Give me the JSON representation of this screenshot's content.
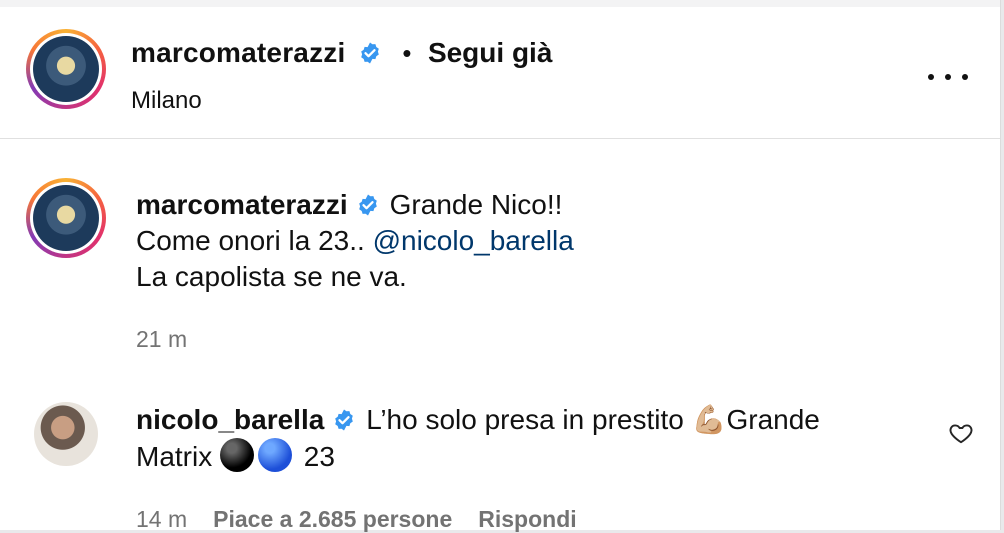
{
  "post": {
    "author": "marcomaterazzi",
    "separator": "•",
    "follow_label": "Segui già",
    "location": "Milano",
    "more_icon": "more-horizontal-icon"
  },
  "comments": [
    {
      "author": "marcomaterazzi",
      "line1": "Grande Nico!!",
      "line2_prefix": "Come onori la 23.. ",
      "mention": "@nicolo_barella",
      "line3": "La capolista se ne va.",
      "time": "21 m"
    },
    {
      "author": "nicolo_barella",
      "text_before": "L’ho solo presa in prestito ",
      "emoji_arm": "💪🏼",
      "text_after": "Grande",
      "line2_prefix": "Matrix ",
      "emoji_black": "⚫",
      "emoji_blue": "🔵",
      "line2_suffix": " 23",
      "time": "14 m",
      "likes": "Piace a 2.685 persone",
      "reply": "Rispondi"
    }
  ],
  "colors": {
    "verified": "#3897f0",
    "mention": "#00376b",
    "meta": "#737373"
  }
}
